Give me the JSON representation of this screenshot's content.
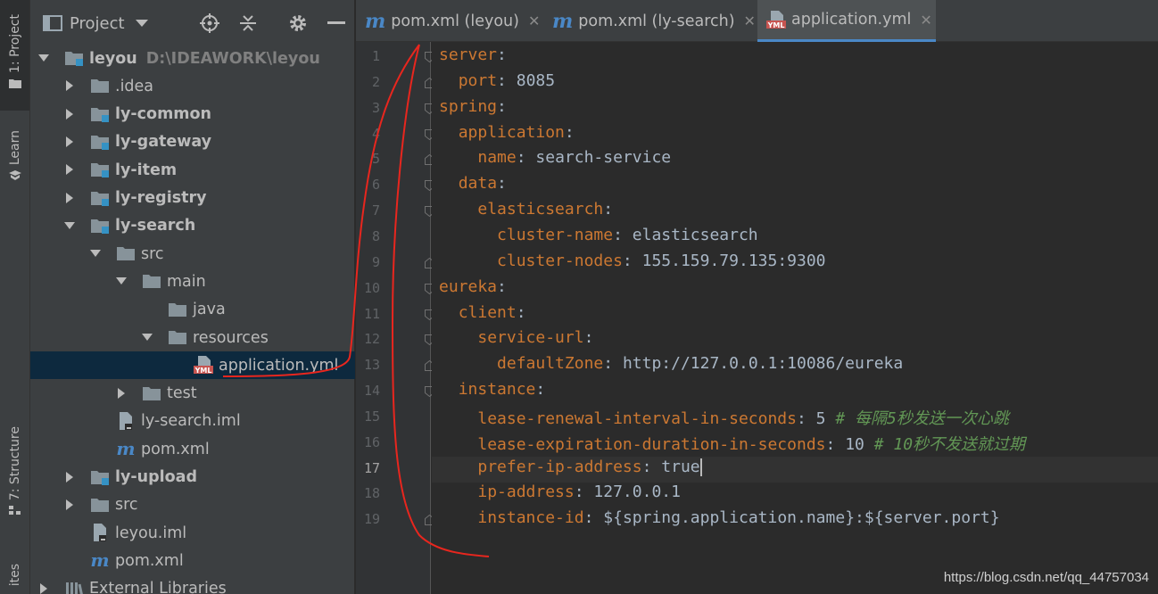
{
  "toolstrip": {
    "project_label": "1: Project",
    "learn_label": "Learn",
    "structure_label": "7: Structure",
    "favorites_label": "ites"
  },
  "project_panel": {
    "title": "Project",
    "tree": [
      {
        "label": "leyou",
        "path": "D:\\IDEAWORK\\leyou",
        "bold": true,
        "icon": "module-folder-icon",
        "arrow": "down"
      },
      {
        "label": ".idea",
        "bold": false,
        "icon": "folder-icon",
        "arrow": "right"
      },
      {
        "label": "ly-common",
        "bold": true,
        "icon": "module-folder-icon",
        "arrow": "right"
      },
      {
        "label": "ly-gateway",
        "bold": true,
        "icon": "module-folder-icon",
        "arrow": "right"
      },
      {
        "label": "ly-item",
        "bold": true,
        "icon": "module-folder-icon",
        "arrow": "right"
      },
      {
        "label": "ly-registry",
        "bold": true,
        "icon": "module-folder-icon",
        "arrow": "right"
      },
      {
        "label": "ly-search",
        "bold": true,
        "icon": "module-folder-icon",
        "arrow": "down"
      },
      {
        "label": "src",
        "bold": false,
        "icon": "folder-icon",
        "arrow": "down"
      },
      {
        "label": "main",
        "bold": false,
        "icon": "folder-icon",
        "arrow": "down"
      },
      {
        "label": "java",
        "bold": false,
        "icon": "folder-icon",
        "arrow": ""
      },
      {
        "label": "resources",
        "bold": false,
        "icon": "folder-icon",
        "arrow": "down"
      },
      {
        "label": "application.yml",
        "bold": false,
        "icon": "yml-file-icon",
        "arrow": "",
        "selected": true
      },
      {
        "label": "test",
        "bold": false,
        "icon": "folder-icon",
        "arrow": "right"
      },
      {
        "label": "ly-search.iml",
        "bold": false,
        "icon": "iml-file-icon",
        "arrow": ""
      },
      {
        "label": "pom.xml",
        "bold": false,
        "icon": "maven-icon",
        "arrow": ""
      },
      {
        "label": "ly-upload",
        "bold": true,
        "icon": "module-folder-icon",
        "arrow": "right"
      },
      {
        "label": "src",
        "bold": false,
        "icon": "folder-icon",
        "arrow": "right"
      },
      {
        "label": "leyou.iml",
        "bold": false,
        "icon": "iml-file-icon",
        "arrow": ""
      },
      {
        "label": "pom.xml",
        "bold": false,
        "icon": "maven-icon",
        "arrow": ""
      },
      {
        "label": "External Libraries",
        "bold": false,
        "icon": "libraries-icon",
        "arrow": "right"
      }
    ]
  },
  "editor_tabs": [
    {
      "label": "pom.xml (leyou)",
      "icon": "maven-icon",
      "active": false
    },
    {
      "label": "pom.xml (ly-search)",
      "icon": "maven-icon",
      "active": false
    },
    {
      "label": "application.yml",
      "icon": "yml-file-icon",
      "active": true
    }
  ],
  "editor": {
    "current_line": 17,
    "lines": [
      {
        "n": "1",
        "key": "server",
        "sep": ":",
        "val": "",
        "comment": "",
        "indent": 0
      },
      {
        "n": "2",
        "key": "port",
        "sep": ": ",
        "val": "8085",
        "comment": "",
        "indent": 1
      },
      {
        "n": "3",
        "key": "spring",
        "sep": ":",
        "val": "",
        "comment": "",
        "indent": 0
      },
      {
        "n": "4",
        "key": "application",
        "sep": ":",
        "val": "",
        "comment": "",
        "indent": 1
      },
      {
        "n": "5",
        "key": "name",
        "sep": ": ",
        "val": "search-service",
        "comment": "",
        "indent": 2
      },
      {
        "n": "6",
        "key": "data",
        "sep": ":",
        "val": "",
        "comment": "",
        "indent": 1
      },
      {
        "n": "7",
        "key": "elasticsearch",
        "sep": ":",
        "val": "",
        "comment": "",
        "indent": 2
      },
      {
        "n": "8",
        "key": "cluster-name",
        "sep": ": ",
        "val": "elasticsearch",
        "comment": "",
        "indent": 3
      },
      {
        "n": "9",
        "key": "cluster-nodes",
        "sep": ": ",
        "val": "155.159.79.135:9300",
        "comment": "",
        "indent": 3
      },
      {
        "n": "10",
        "key": "eureka",
        "sep": ":",
        "val": "",
        "comment": "",
        "indent": 0
      },
      {
        "n": "11",
        "key": "client",
        "sep": ":",
        "val": "",
        "comment": "",
        "indent": 1
      },
      {
        "n": "12",
        "key": "service-url",
        "sep": ":",
        "val": "",
        "comment": "",
        "indent": 2
      },
      {
        "n": "13",
        "key": "defaultZone",
        "sep": ": ",
        "val": "http://127.0.0.1:10086/eureka",
        "comment": "",
        "indent": 3
      },
      {
        "n": "14",
        "key": "instance",
        "sep": ":",
        "val": "",
        "comment": "",
        "indent": 1
      },
      {
        "n": "15",
        "key": "lease-renewal-interval-in-seconds",
        "sep": ": ",
        "val": "5",
        "comment": " # 每隔5秒发送一次心跳",
        "indent": 2
      },
      {
        "n": "16",
        "key": "lease-expiration-duration-in-seconds",
        "sep": ": ",
        "val": "10",
        "comment": " # 10秒不发送就过期",
        "indent": 2
      },
      {
        "n": "17",
        "key": "prefer-ip-address",
        "sep": ": ",
        "val": "true",
        "comment": "",
        "indent": 2
      },
      {
        "n": "18",
        "key": "ip-address",
        "sep": ": ",
        "val": "127.0.0.1",
        "comment": "",
        "indent": 2
      },
      {
        "n": "19",
        "key": "instance-id",
        "sep": ": ",
        "val": "${spring.application.name}:${server.port}",
        "comment": "",
        "indent": 2
      }
    ]
  },
  "watermark": "https://blog.csdn.net/qq_44757034",
  "colors": {
    "accent": "#4a88c7",
    "yaml_key": "#cc7832",
    "yaml_value": "#a9b7c6",
    "comment": "#629755",
    "annotation": "#e8261e"
  }
}
